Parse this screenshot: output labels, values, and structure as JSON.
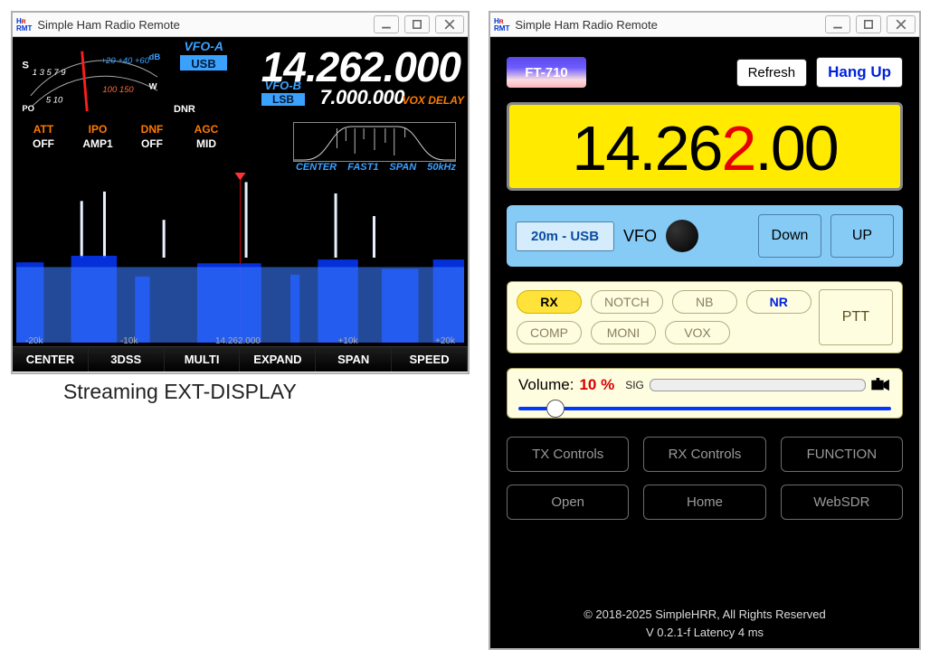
{
  "app_title": "Simple Ham Radio Remote",
  "stream_caption": "Streaming EXT-DISPLAY",
  "display": {
    "vfoA_label": "VFO-A",
    "vfoA_mode": "USB",
    "freqA": "14.262.000",
    "vfoB_label": "VFO-B",
    "vfoB_mode": "LSB",
    "freqB": "7.000.000",
    "vox_delay": "VOX DELAY",
    "dnr": "DNR",
    "meter": {
      "s_label": "S",
      "s_ticks": "1  3  5  7  9",
      "db_plus": "+20 +40 +60",
      "db_lbl": "dB",
      "po_label": "PO",
      "po_ticks": "5  10  100 150",
      "w_lbl": "W"
    },
    "indicators": [
      {
        "k": "ATT",
        "v": "OFF"
      },
      {
        "k": "IPO",
        "v": "AMP1"
      },
      {
        "k": "DNF",
        "v": "OFF"
      },
      {
        "k": "AGC",
        "v": "MID"
      }
    ],
    "scope_meta": {
      "center": "CENTER",
      "rate": "FAST1",
      "span_lbl": "SPAN",
      "span_val": "50kHz"
    },
    "xscale": [
      "-20k",
      "-10k",
      "14.262.000",
      "+10k",
      "+20k"
    ],
    "softkeys": [
      "CENTER",
      "3DSS",
      "MULTI",
      "EXPAND",
      "SPAN",
      "SPEED"
    ]
  },
  "right": {
    "radio_model": "FT-710",
    "refresh": "Refresh",
    "hangup": "Hang Up",
    "freq_pre": "14.26",
    "freq_red": "2",
    "freq_post": ".00",
    "band_chip": "20m - USB",
    "vfo": "VFO",
    "down": "Down",
    "up": "UP",
    "dsp_row1": [
      "RX",
      "NOTCH",
      "NB",
      "NR"
    ],
    "dsp_row2": [
      "COMP",
      "MONI",
      "VOX"
    ],
    "ptt": "PTT",
    "vol_label": "Volume:",
    "vol_pct": "10 %",
    "vol_value": 10,
    "sig": "SIG",
    "ctrl_buttons": [
      "TX Controls",
      "RX Controls",
      "FUNCTION",
      "Open",
      "Home",
      "WebSDR"
    ],
    "copyright": "© 2018-2025 SimpleHRR,  All Rights Reserved",
    "version": "V 0.2.1-f  Latency   4   ms"
  }
}
